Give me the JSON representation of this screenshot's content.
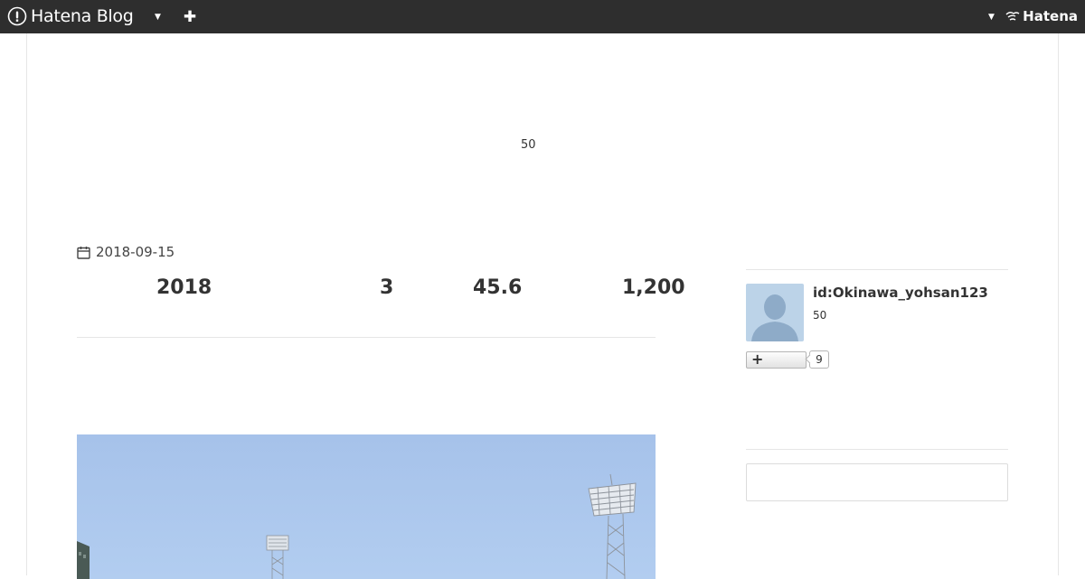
{
  "topbar": {
    "brand": "Hatena Blog",
    "logo_text": "Hatena",
    "icons": [
      "hatena-blog-logo-icon",
      "chevron-down-icon",
      "plus-icon",
      "chevron-down-icon",
      "hatena-logo-icon"
    ]
  },
  "ad_count": "50",
  "entry": {
    "date": "2018-09-15",
    "stats": [
      "2018",
      "3",
      "45.6",
      "1,200"
    ]
  },
  "sidebar": {
    "user_id": "id:Okinawa_yohsan123",
    "count": "50",
    "subscribe_plus": "+",
    "subscribe_count": "9"
  },
  "colors": {
    "topbar": "#2e2e2e",
    "sky": "#a6c2ea",
    "avatar_bg": "#bcd3e8",
    "avatar_silhouette": "#8eabc8"
  }
}
